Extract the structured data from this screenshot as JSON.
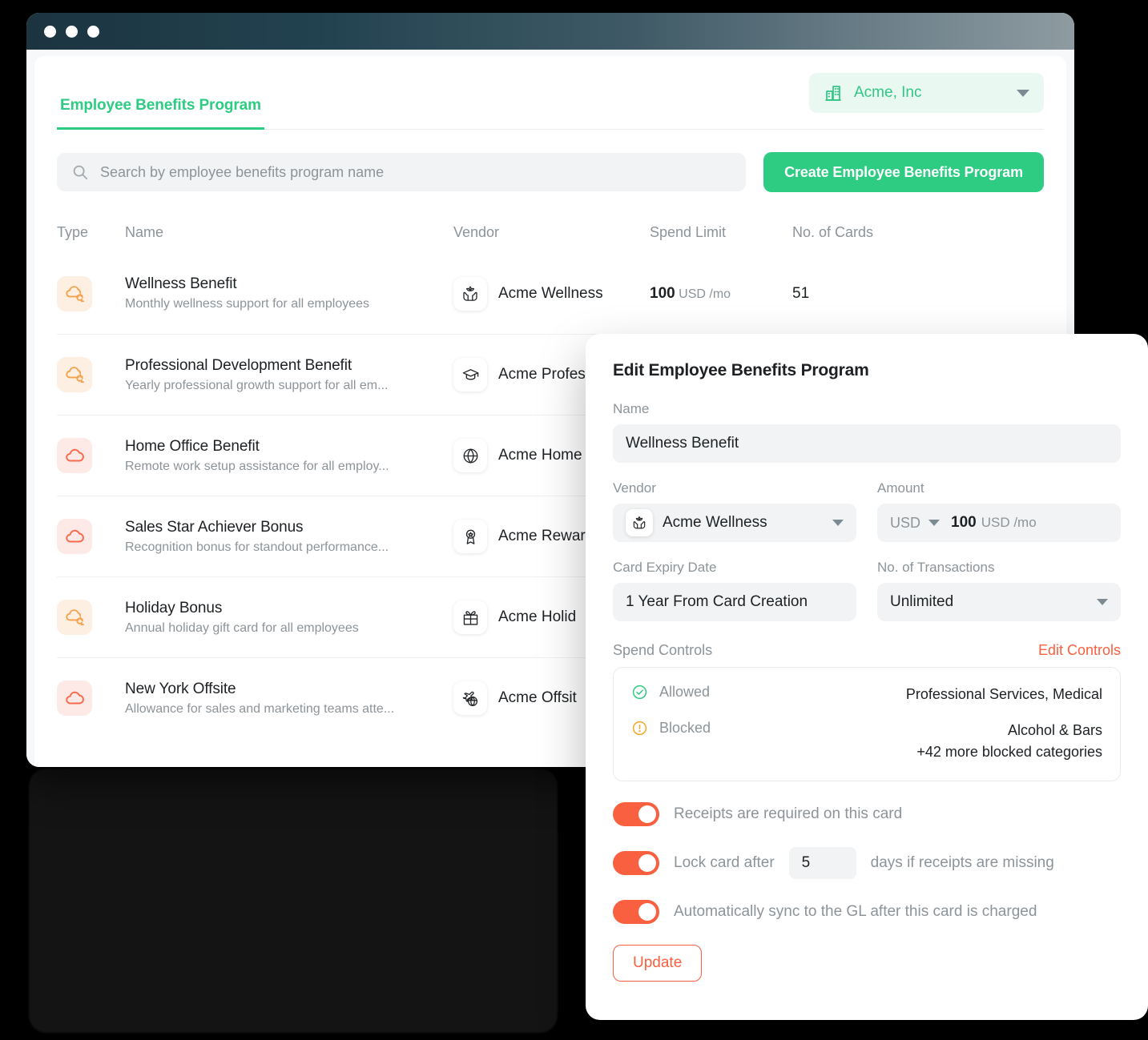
{
  "window": {
    "traffic_lights": [
      "close",
      "minimize",
      "maximize"
    ]
  },
  "header": {
    "tab_label": "Employee Benefits Program",
    "org_selector": {
      "icon": "building-icon",
      "label": "Acme, Inc",
      "caret": "chevron-down-icon"
    }
  },
  "toolbar": {
    "search_placeholder": "Search by employee benefits program name",
    "search_icon": "search-icon",
    "create_label": "Create Employee Benefits Program"
  },
  "table": {
    "columns": [
      "Type",
      "Name",
      "Vendor",
      "Spend Limit",
      "No. of Cards"
    ],
    "rows": [
      {
        "type_icon": "cloud-recurring-icon",
        "type_kind": "recurring",
        "name": "Wellness Benefit",
        "description": "Monthly wellness support for all employees",
        "vendor_icon": "lotus-in-hands-icon",
        "vendor": "Acme Wellness",
        "spend_amount": "100",
        "spend_unit": "USD /mo",
        "cards": "51"
      },
      {
        "type_icon": "cloud-recurring-icon",
        "type_kind": "recurring",
        "name": "Professional Development Benefit",
        "description": "Yearly professional growth support for all em...",
        "vendor_icon": "graduation-cap-icon",
        "vendor": "Acme Profes",
        "spend_amount": "",
        "spend_unit": "",
        "cards": ""
      },
      {
        "type_icon": "cloud-icon",
        "type_kind": "onetime",
        "name": "Home Office Benefit",
        "description": "Remote work setup assistance for all employ...",
        "vendor_icon": "globe-icon",
        "vendor": "Acme Home",
        "spend_amount": "",
        "spend_unit": "",
        "cards": ""
      },
      {
        "type_icon": "cloud-icon",
        "type_kind": "onetime",
        "name": "Sales Star Achiever Bonus",
        "description": "Recognition bonus for standout performance...",
        "vendor_icon": "award-ribbon-icon",
        "vendor": "Acme Rewar",
        "spend_amount": "",
        "spend_unit": "",
        "cards": ""
      },
      {
        "type_icon": "cloud-recurring-icon",
        "type_kind": "recurring",
        "name": "Holiday Bonus",
        "description": "Annual holiday gift card for all employees",
        "vendor_icon": "gift-icon",
        "vendor": "Acme Holid",
        "spend_amount": "",
        "spend_unit": "",
        "cards": ""
      },
      {
        "type_icon": "cloud-icon",
        "type_kind": "onetime",
        "name": "New York Offsite",
        "description": "Allowance for sales and marketing teams atte...",
        "vendor_icon": "plane-globe-icon",
        "vendor": "Acme Offsit",
        "spend_amount": "",
        "spend_unit": "",
        "cards": ""
      }
    ]
  },
  "modal": {
    "title": "Edit Employee Benefits Program",
    "name": {
      "label": "Name",
      "value": "Wellness Benefit"
    },
    "vendor": {
      "label": "Vendor",
      "value": "Acme Wellness",
      "icon": "lotus-in-hands-icon"
    },
    "amount": {
      "label": "Amount",
      "currency": "USD",
      "value": "100",
      "unit": "USD /mo"
    },
    "card_expiry": {
      "label": "Card Expiry Date",
      "value": "1 Year From Card Creation"
    },
    "transactions": {
      "label": "No. of Transactions",
      "value": "Unlimited"
    },
    "spend_controls": {
      "title": "Spend Controls",
      "edit_label": "Edit Controls",
      "allowed_label": "Allowed",
      "allowed_value": "Professional Services, Medical",
      "blocked_label": "Blocked",
      "blocked_value": "Alcohol & Bars",
      "blocked_more": "+42 more blocked categories"
    },
    "toggles": {
      "receipts_label": "Receipts are required on this card",
      "lock_label_before": "Lock card after",
      "lock_days": "5",
      "lock_label_after": "days if receipts are missing",
      "sync_label": "Automatically sync to the GL after this card is charged"
    },
    "update_label": "Update"
  },
  "colors": {
    "brand_green": "#2ecc82",
    "accent_orange": "#f9603f",
    "recurring_icon": "#f5a04a",
    "onetime_icon": "#fa6a4e",
    "allowed_green": "#2ecc82",
    "blocked_amber": "#f5a623"
  }
}
